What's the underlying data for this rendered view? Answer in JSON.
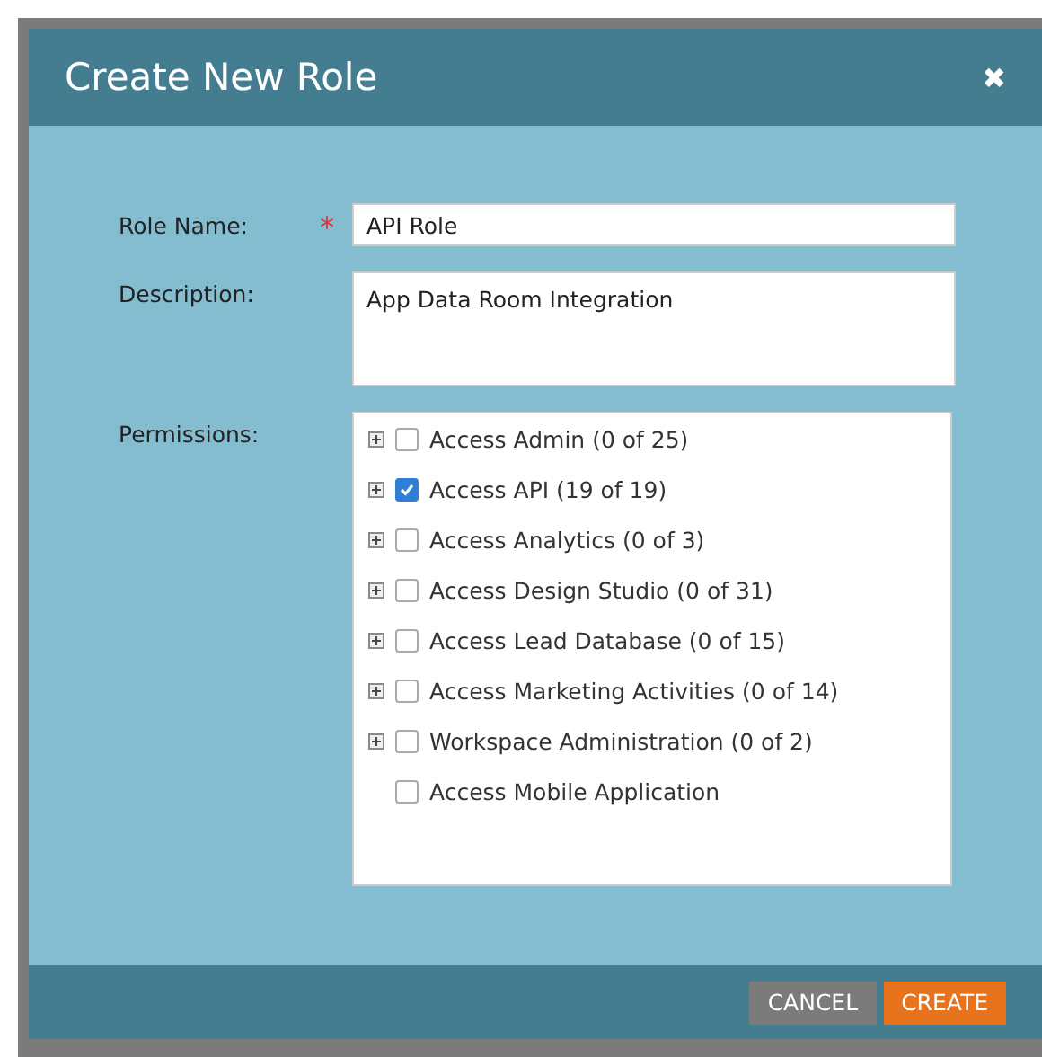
{
  "dialog": {
    "title": "Create New Role",
    "close": "✖"
  },
  "form": {
    "role_name": {
      "label": "Role Name:",
      "required": true,
      "required_mark": "*",
      "value": "API Role"
    },
    "description": {
      "label": "Description:",
      "value": "App Data Room Integration"
    },
    "permissions": {
      "label": "Permissions:",
      "items": [
        {
          "kind": "group",
          "label": "Access Admin (0 of 25)",
          "checked": false,
          "expanded": false
        },
        {
          "kind": "group",
          "label": "Access API (19 of 19)",
          "checked": true,
          "expanded": false
        },
        {
          "kind": "group",
          "label": "Access Analytics (0 of 3)",
          "checked": false,
          "expanded": false
        },
        {
          "kind": "group",
          "label": "Access Design Studio (0 of 31)",
          "checked": false,
          "expanded": false
        },
        {
          "kind": "group",
          "label": "Access Lead Database (0 of 15)",
          "checked": false,
          "expanded": false
        },
        {
          "kind": "group",
          "label": "Access Marketing Activities (0 of 14)",
          "checked": false,
          "expanded": false
        },
        {
          "kind": "group",
          "label": "Workspace Administration (0 of 2)",
          "checked": false,
          "expanded": false
        },
        {
          "kind": "leaf",
          "label": "Access Mobile Application",
          "checked": false
        }
      ]
    }
  },
  "buttons": [
    {
      "kind": "secondary",
      "label": "CANCEL"
    },
    {
      "kind": "primary",
      "label": "CREATE"
    }
  ]
}
